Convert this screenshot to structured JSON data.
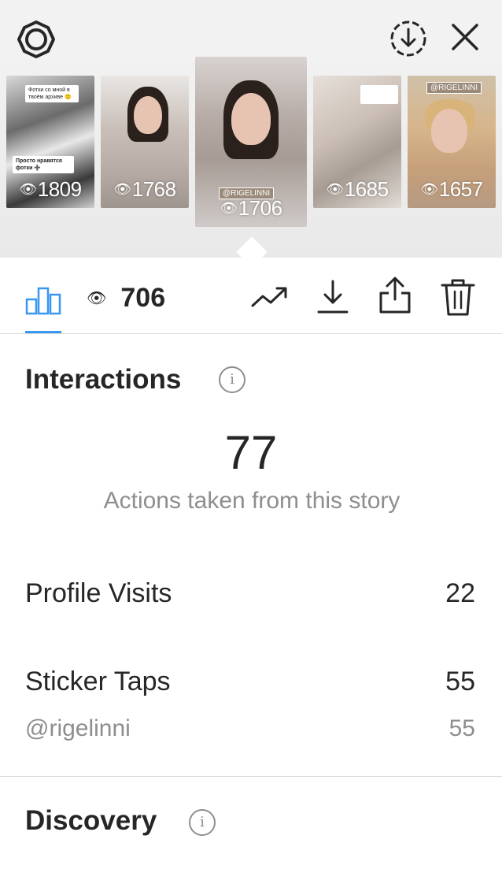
{
  "stories": [
    {
      "views": "1809",
      "note_a": "Фотки со мной в твоём архиве 🙂",
      "note_b": "Просто нравятся фотки ➕"
    },
    {
      "views": "1768"
    },
    {
      "views": "1706",
      "tag": "@RIGELINNI"
    },
    {
      "views": "1685"
    },
    {
      "views": "1657",
      "tag": "@RIGELINNI"
    }
  ],
  "eye_glyph": "👁",
  "views_total": "706",
  "interactions": {
    "title": "Interactions",
    "info": "i",
    "total": "77",
    "caption": "Actions taken from this story",
    "rows": [
      {
        "label": "Profile Visits",
        "value": "22"
      },
      {
        "label": "Sticker Taps",
        "value": "55"
      }
    ],
    "sub_rows": [
      {
        "label": "@rigelinni",
        "value": "55"
      }
    ]
  },
  "discovery": {
    "title": "Discovery",
    "info": "i"
  },
  "colors": {
    "accent": "#3897f0",
    "text": "#262626",
    "secondary": "#8e8e8e"
  }
}
